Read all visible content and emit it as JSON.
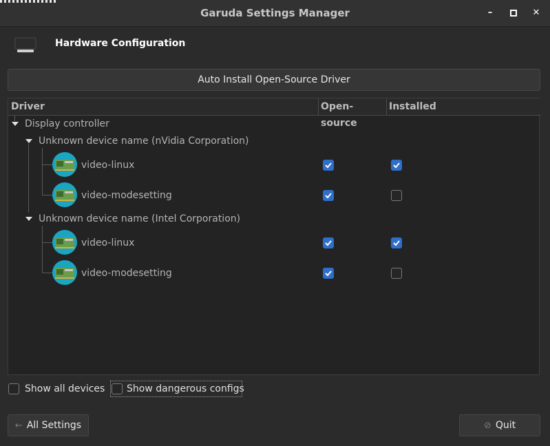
{
  "window": {
    "title": "Garuda Settings Manager"
  },
  "header": {
    "title": "Hardware Configuration",
    "icon": "monitor-icon"
  },
  "toolbar": {
    "auto_install_label": "Auto Install Open-Source Driver"
  },
  "tree": {
    "columns": [
      "Driver",
      "Open-source",
      "Installed"
    ],
    "root": {
      "label": "Display controller"
    },
    "devices": [
      {
        "label": "Unknown device name (nVidia Corporation)",
        "drivers": [
          {
            "name": "video-linux",
            "open_source": true,
            "installed": true
          },
          {
            "name": "video-modesetting",
            "open_source": true,
            "installed": false
          }
        ]
      },
      {
        "label": "Unknown device name (Intel Corporation)",
        "drivers": [
          {
            "name": "video-linux",
            "open_source": true,
            "installed": true
          },
          {
            "name": "video-modesetting",
            "open_source": true,
            "installed": false
          }
        ]
      }
    ]
  },
  "options": {
    "show_all_devices": {
      "label": "Show all devices",
      "checked": false
    },
    "show_dangerous": {
      "label": "Show dangerous configs",
      "checked": false
    }
  },
  "footer": {
    "all_settings_label": "All Settings",
    "quit_label": "Quit"
  },
  "colors": {
    "accent": "#2f6fc9",
    "driver_icon_bg": "#1aa6c2"
  }
}
